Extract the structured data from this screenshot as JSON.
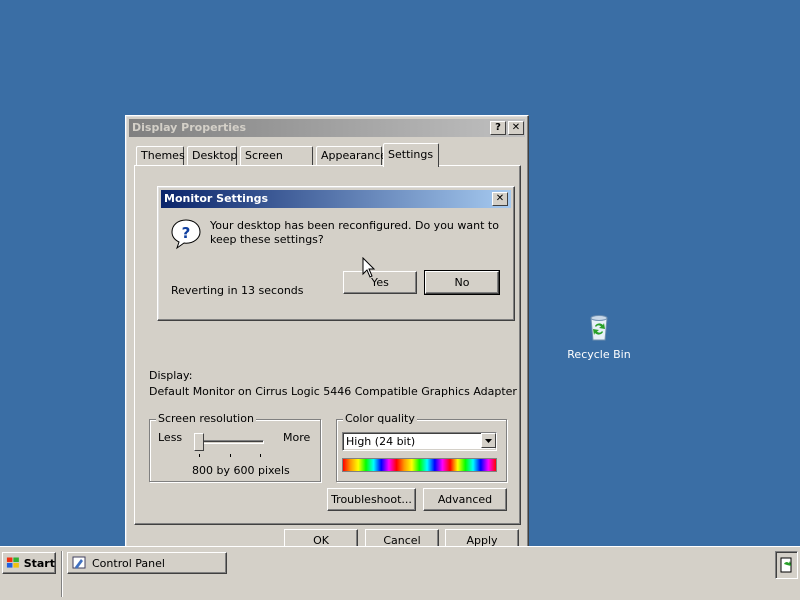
{
  "desktop": {
    "recycle_bin_label": "Recycle Bin"
  },
  "display_window": {
    "title": "Display Properties",
    "help_label": "?",
    "close_label": "✕",
    "tabs": [
      {
        "label": "Themes"
      },
      {
        "label": "Desktop"
      },
      {
        "label": "Screen Saver"
      },
      {
        "label": "Appearance"
      },
      {
        "label": "Settings"
      }
    ],
    "active_tab": "Settings",
    "display_label": "Display:",
    "display_value": "Default Monitor on Cirrus Logic 5446 Compatible Graphics Adapter",
    "resolution": {
      "group_label": "Screen resolution",
      "less_label": "Less",
      "more_label": "More",
      "value_text": "800 by 600 pixels",
      "slider_level": 0.0
    },
    "color_quality": {
      "group_label": "Color quality",
      "selected": "High (24 bit)"
    },
    "troubleshoot_label": "Troubleshoot...",
    "advanced_label": "Advanced",
    "ok_label": "OK",
    "cancel_label": "Cancel",
    "apply_label": "Apply"
  },
  "monitor_dialog": {
    "title": "Monitor Settings",
    "close_label": "✕",
    "message": "Your desktop has been reconfigured.  Do you want to keep these settings?",
    "countdown": "Reverting in 13 seconds",
    "yes_label": "Yes",
    "no_label": "No"
  },
  "taskbar": {
    "start_label": "Start",
    "task_label": "Control Panel"
  },
  "colors": {
    "desktop": "#3a6ea5",
    "face": "#d4d0c8",
    "active_title": "#0a246a",
    "inactive_title": "#808080"
  }
}
